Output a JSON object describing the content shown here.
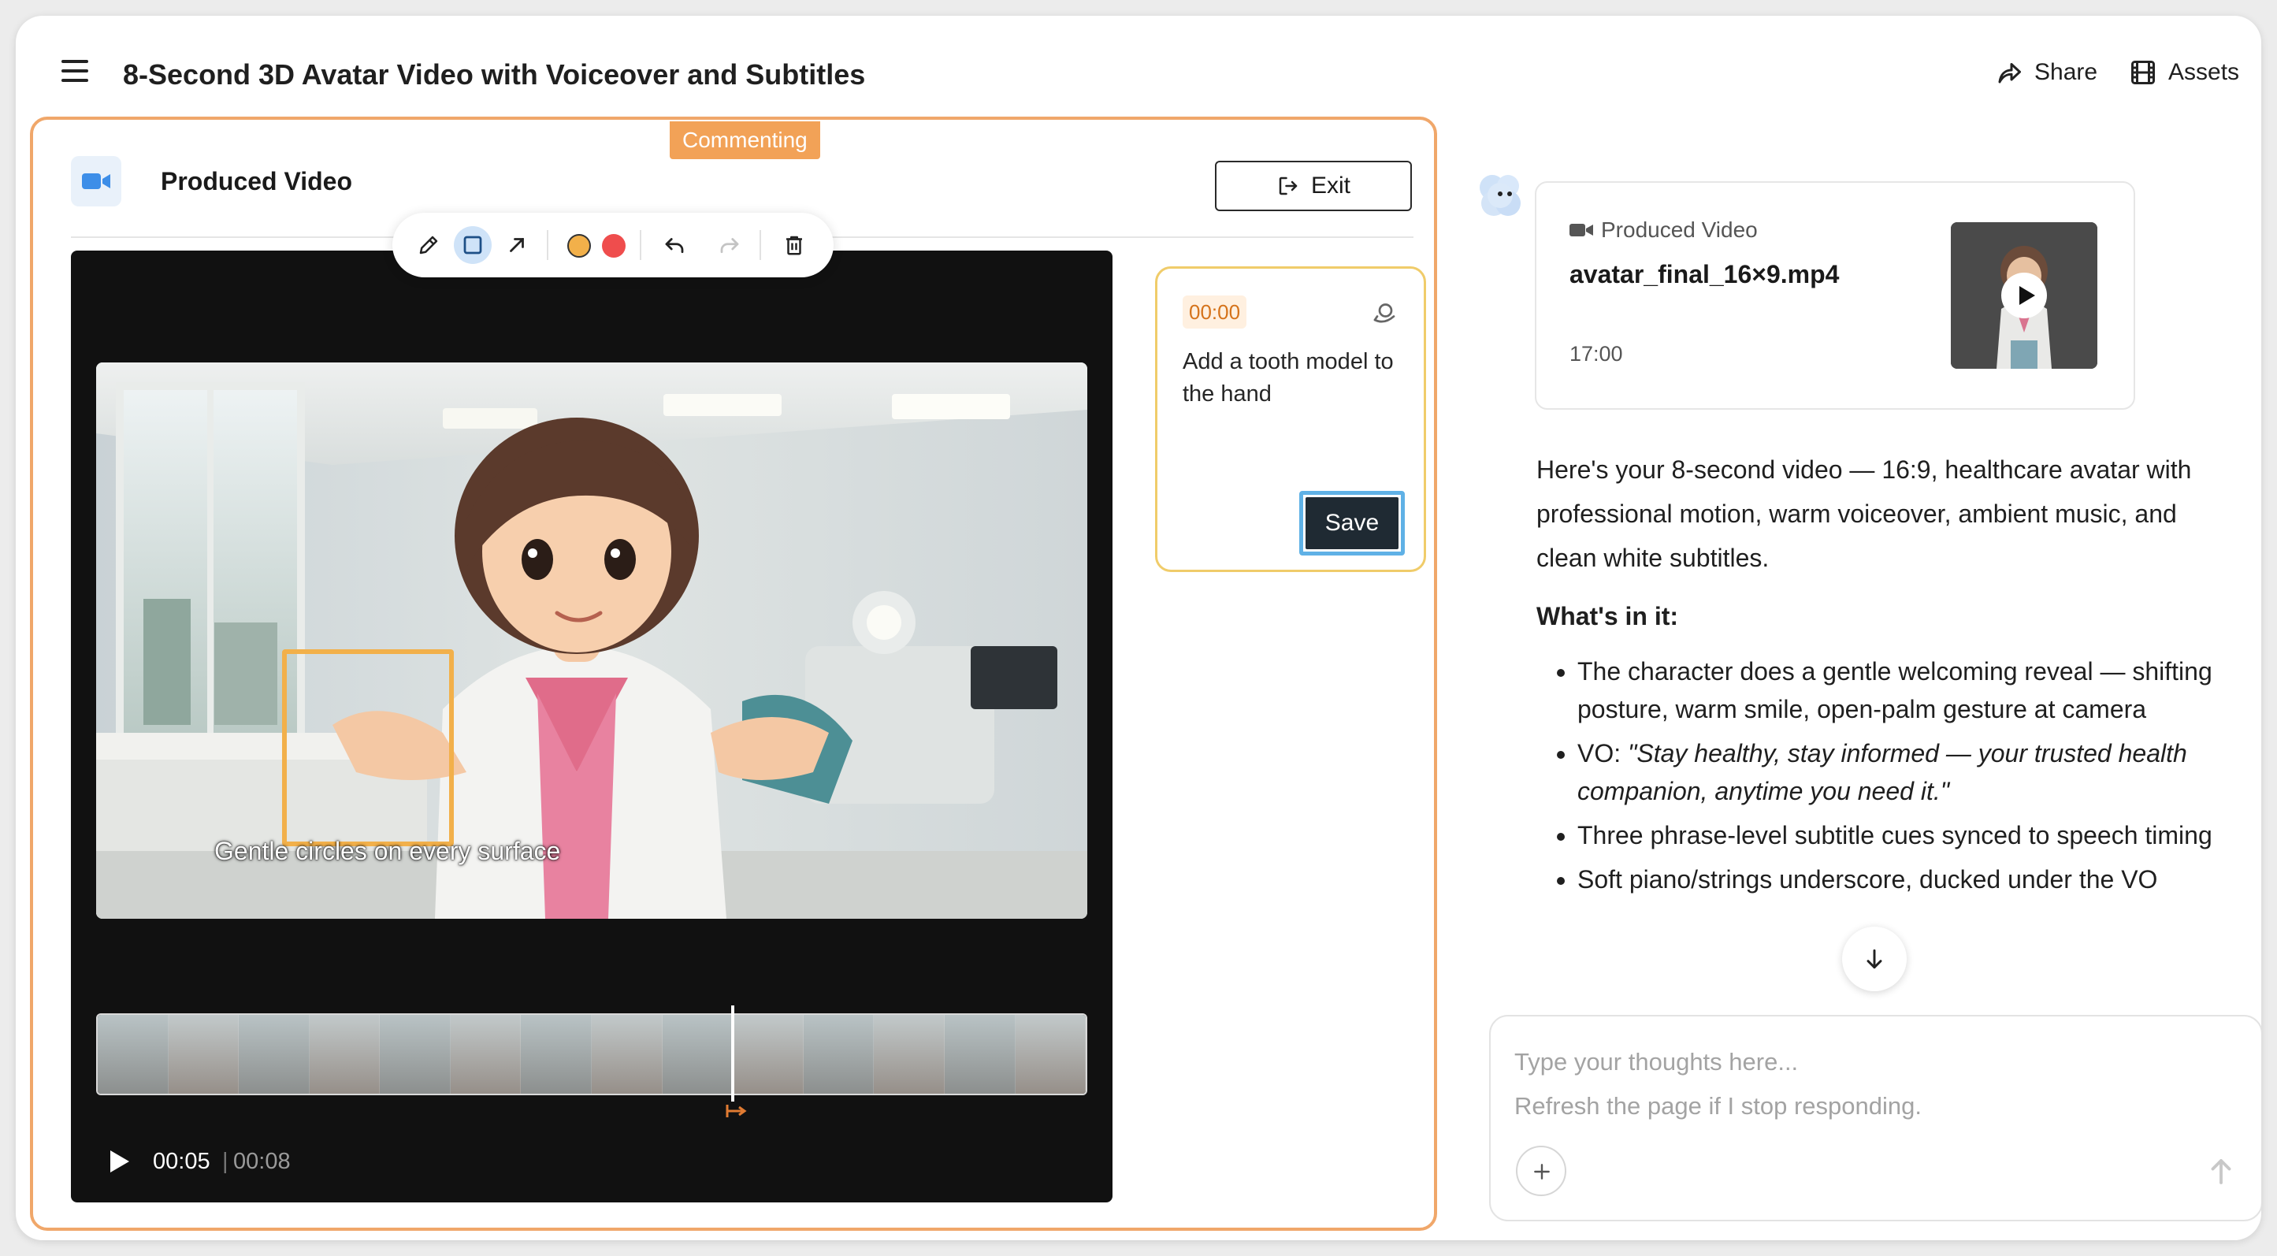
{
  "header": {
    "title": "8-Second 3D Avatar Video with Voiceover and Subtitles",
    "share_label": "Share",
    "assets_label": "Assets"
  },
  "editor": {
    "mode_badge": "Commenting",
    "panel_title": "Produced Video",
    "exit_label": "Exit",
    "toolbar": {
      "tools": [
        "pencil-icon",
        "rectangle-icon",
        "arrow-icon"
      ],
      "active_tool": "rectangle-icon",
      "colors": [
        "#f2b04a",
        "#ef4d4d"
      ],
      "actions": [
        "undo-icon",
        "redo-icon",
        "trash-icon"
      ]
    },
    "player": {
      "subtitle": "Gentle circles on every surface",
      "current_time": "00:05",
      "time_separator": "|",
      "total_time": "00:08",
      "annotation_color": "#f2b04a"
    },
    "comment": {
      "timestamp": "00:00",
      "text": "Add a tooth model to the hand",
      "save_label": "Save"
    }
  },
  "assistant": {
    "file_card": {
      "label": "Produced Video",
      "filename": "avatar_final_16×9.mp4",
      "time": "17:00"
    },
    "intro": "Here's your 8-second video — 16:9, healthcare avatar with professional motion, warm voiceover, ambient music, and clean white subtitles.",
    "section_title": "What's in it:",
    "bullets": [
      {
        "text": "The character does a gentle welcoming reveal — shifting posture, warm smile, open-palm gesture at camera"
      },
      {
        "prefix": "VO: ",
        "quote": "\"Stay healthy, stay informed — your trusted health companion, anytime you need it.\""
      },
      {
        "text": "Three phrase-level subtitle cues synced to speech timing"
      },
      {
        "text": "Soft piano/strings underscore, ducked under the VO"
      }
    ]
  },
  "composer": {
    "placeholder": "Type your thoughts here...\nRefresh the page if I stop responding."
  },
  "colors": {
    "accent_orange": "#f0a76a",
    "comment_border": "#f0cc6a",
    "save_focus": "#5fb1e6",
    "tool_active": "#cfe3f8"
  }
}
